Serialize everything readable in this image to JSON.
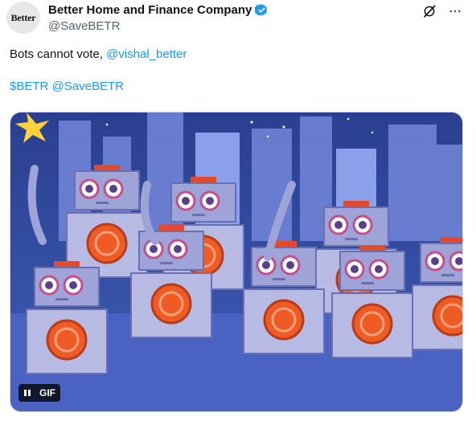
{
  "author": {
    "avatar_text": "Better",
    "name": "Better Home and Finance Company",
    "handle": "@SaveBETR",
    "verified_color": "#1d9bf0"
  },
  "tweet": {
    "line1_text": "Bots cannot vote, ",
    "line1_mention": "@vishal_better",
    "line2_tag": "$BETR",
    "line2_mention": "@SaveBETR"
  },
  "media": {
    "type": "gif",
    "badge_label": "GIF",
    "description_icon": "pause-icon"
  },
  "icons": {
    "grok": "grok-icon",
    "more": "more-icon"
  },
  "colors": {
    "link": "#1d9bf0",
    "text": "#0f1419",
    "secondary": "#536471"
  }
}
